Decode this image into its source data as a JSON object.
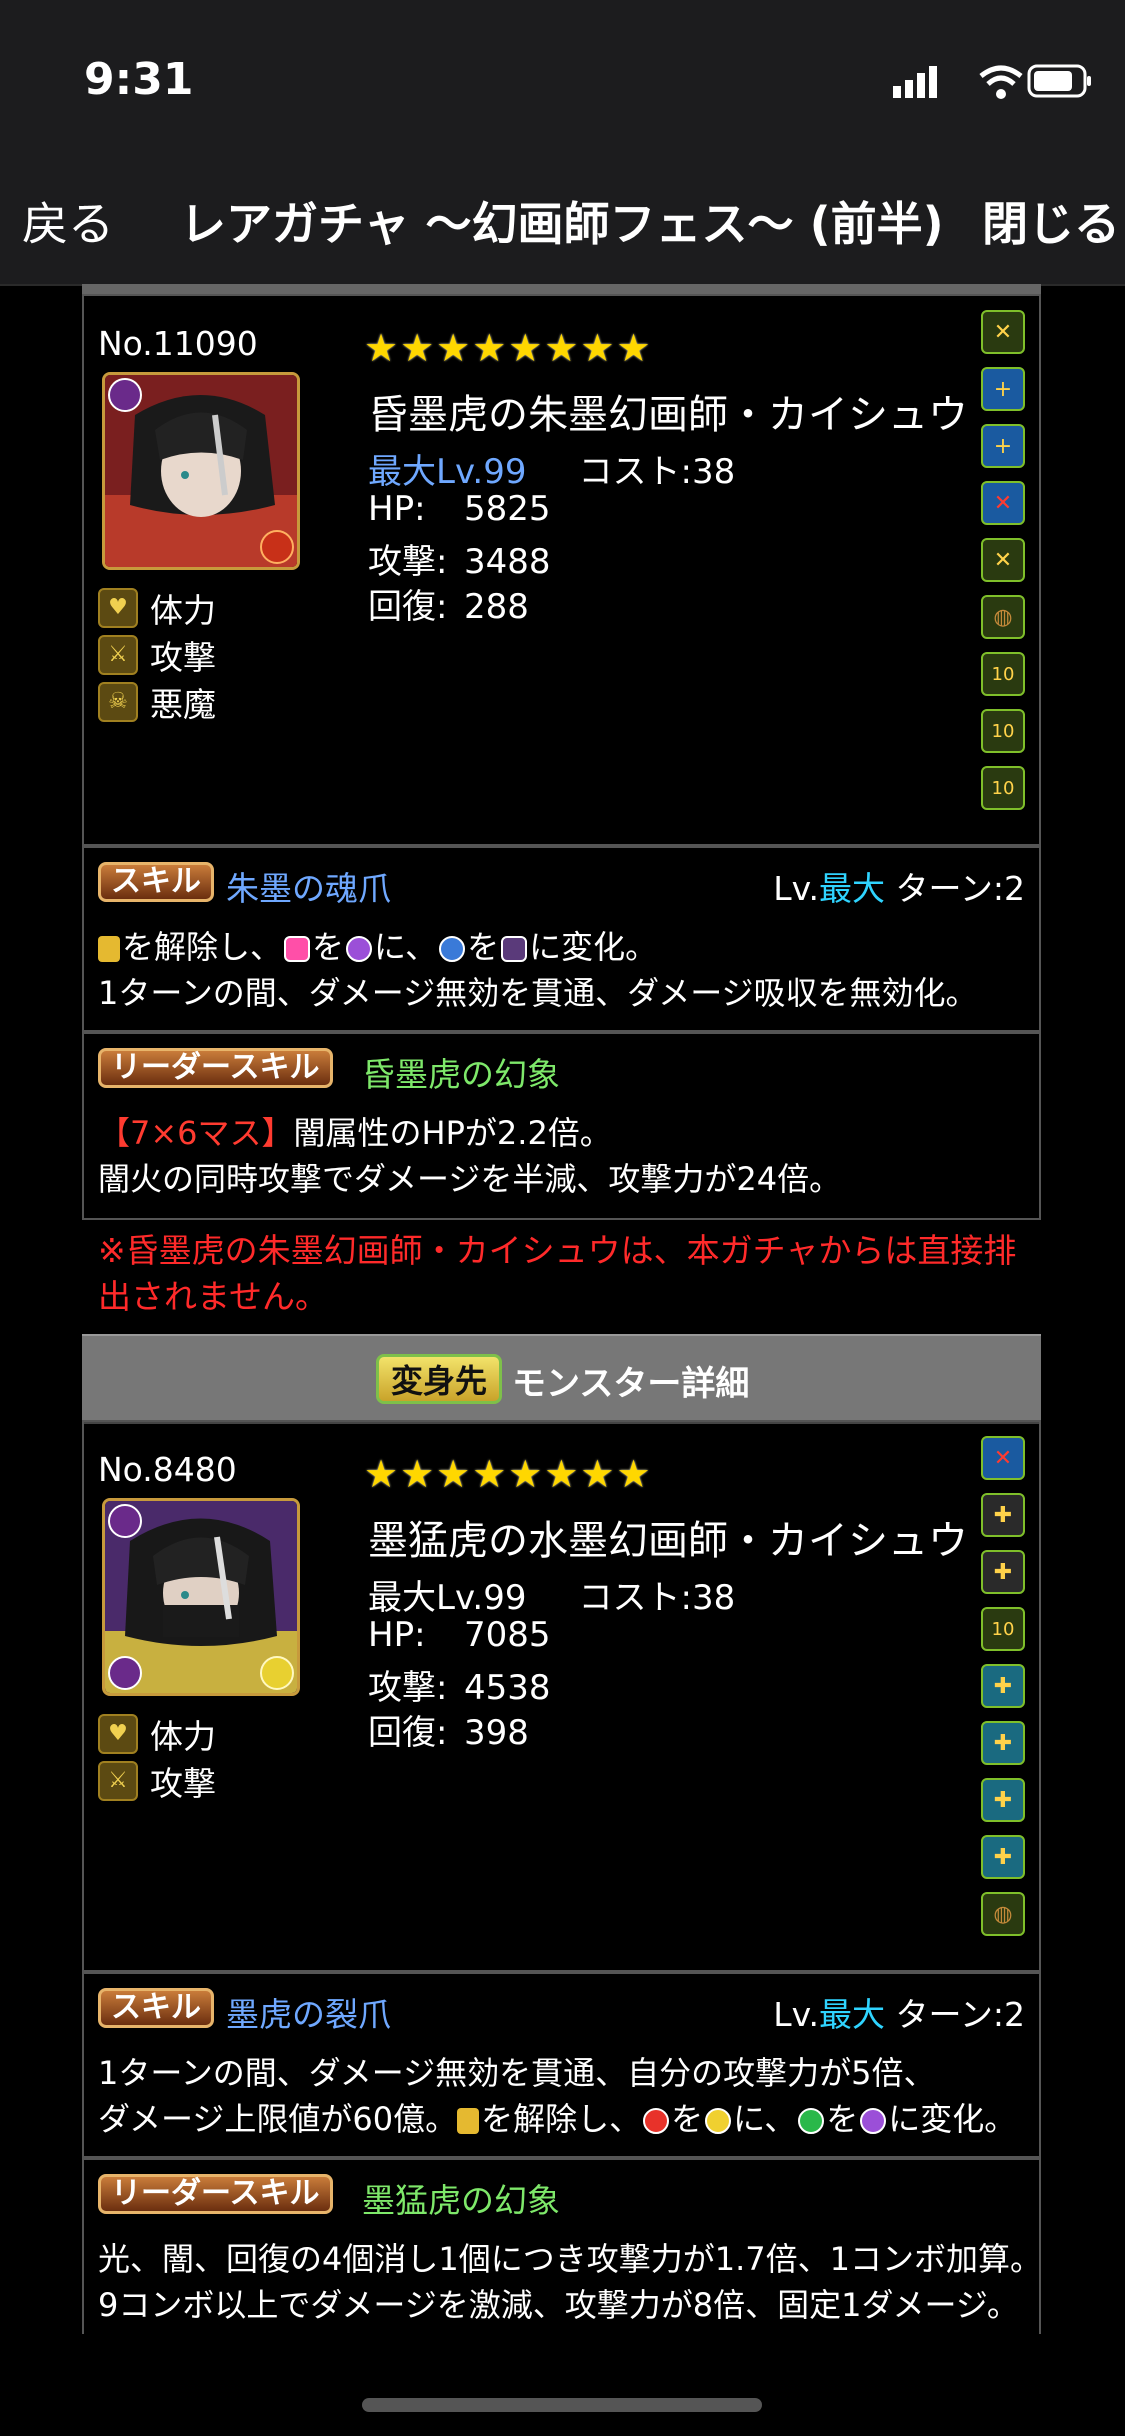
{
  "status": {
    "time": "9:31"
  },
  "nav": {
    "back": "戻る",
    "title": "レアガチャ 〜幻画師フェス〜 (前半)",
    "close": "閉じる"
  },
  "monster1": {
    "no": "No.11090",
    "stars": "★★★★★★★★",
    "name": "昏墨虎の朱墨幻画師・カイシュウ",
    "max_lv": "最大Lv.99",
    "cost": "コスト:38",
    "hp_label": "HP:",
    "hp": "5825",
    "atk_label": "攻撃:",
    "atk": "3488",
    "rcv_label": "回復:",
    "rcv": "288",
    "types": [
      "体力",
      "攻撃",
      "悪魔"
    ],
    "awakenings": [
      "sword-x-icon",
      "skill-boost-icon",
      "skill-boost-icon",
      "bind-resist-icon",
      "sword-x-icon",
      "barrel-icon",
      "ten-combo-icon",
      "ten-combo-icon",
      "ten-combo-icon"
    ]
  },
  "skill1": {
    "badge": "スキル",
    "name": "朱墨の魂爪",
    "lv_prefix": "Lv.",
    "lv": "最大",
    "turn": "ターン:2",
    "line1_a": "を解除し、",
    "line1_b": "を",
    "line1_c": "に、",
    "line1_d": "を",
    "line1_e": "に変化。",
    "line2": "1ターンの間、ダメージ無効を貫通、ダメージ吸収を無効化。"
  },
  "leader1": {
    "badge": "リーダースキル",
    "name": "昏墨虎の幻象",
    "line1_tag": "【7×6マス】",
    "line1_rest": "闇属性のHPが2.2倍。",
    "line2": "闇火の同時攻撃でダメージを半減、攻撃力が24倍。"
  },
  "note": {
    "line1": "※昏墨虎の朱墨幻画師・カイシュウは、本ガチャからは直接排",
    "line2": "出されません。"
  },
  "transform": {
    "badge": "変身先",
    "title": "モンスター詳細"
  },
  "monster2": {
    "no": "No.8480",
    "stars": "★★★★★★★★",
    "name": "墨猛虎の水墨幻画師・カイシュウ",
    "max_lv": "最大Lv.99",
    "cost": "コスト:38",
    "hp_label": "HP:",
    "hp": "7085",
    "atk_label": "攻撃:",
    "atk": "4538",
    "rcv_label": "回復:",
    "rcv": "398",
    "types": [
      "体力",
      "攻撃"
    ],
    "awakenings": [
      "bind-resist-icon",
      "hand-plus-icon",
      "hand-plus-icon",
      "ten-combo-icon",
      "hand-plus-icon",
      "hand-plus-icon",
      "hand-plus-icon",
      "hand-plus-icon",
      "barrel-icon"
    ]
  },
  "skill2": {
    "badge": "スキル",
    "name": "墨虎の裂爪",
    "lv_prefix": "Lv.",
    "lv": "最大",
    "turn": "ターン:2",
    "line1": "1ターンの間、ダメージ無効を貫通、自分の攻撃力が5倍、",
    "line2_a": "ダメージ上限値が60億。",
    "line2_b": "を解除し、",
    "line2_c": "を",
    "line2_d": "に、",
    "line2_e": "を",
    "line2_f": "に変化。"
  },
  "leader2": {
    "badge": "リーダースキル",
    "name": "墨猛虎の幻象",
    "line1": "光、闇、回復の4個消し1個につき攻撃力が1.7倍、1コンボ加算。",
    "line2": "9コンボ以上でダメージを激減、攻撃力が8倍、固定1ダメージ。"
  }
}
